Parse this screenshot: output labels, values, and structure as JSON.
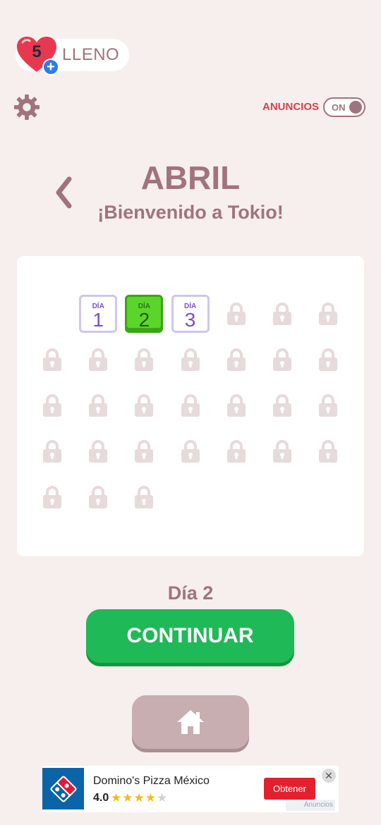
{
  "header": {
    "lives_count": "5",
    "lives_status": "LLENO",
    "ads_label": "ANUNCIOS",
    "ads_toggle": "ON"
  },
  "title": {
    "month": "ABRIL",
    "welcome": "¡Bienvenido a Tokio!"
  },
  "calendar": {
    "days": [
      {
        "dia": "DÍA",
        "num": "1",
        "state": "unlocked"
      },
      {
        "dia": "DÍA",
        "num": "2",
        "state": "current"
      },
      {
        "dia": "DÍA",
        "num": "3",
        "state": "unlocked"
      }
    ],
    "locked_days": 27
  },
  "current_day_label": "Día 2",
  "buttons": {
    "continue": "CONTINUAR",
    "home_icon": "home-icon"
  },
  "ad": {
    "title": "Domino's Pizza México",
    "rating": "4.0",
    "stars_filled": 4,
    "stars_total": 5,
    "cta": "Obtener",
    "close": "✕",
    "tag": "Anuncios"
  },
  "colors": {
    "background": "#f6efed",
    "accent": "#a0737d",
    "ads_red": "#d9404f",
    "continue_green": "#1fb957",
    "current_day_green": "#5bd52a",
    "day_purple": "#7b4fc9",
    "lock": "#e6dadb"
  }
}
